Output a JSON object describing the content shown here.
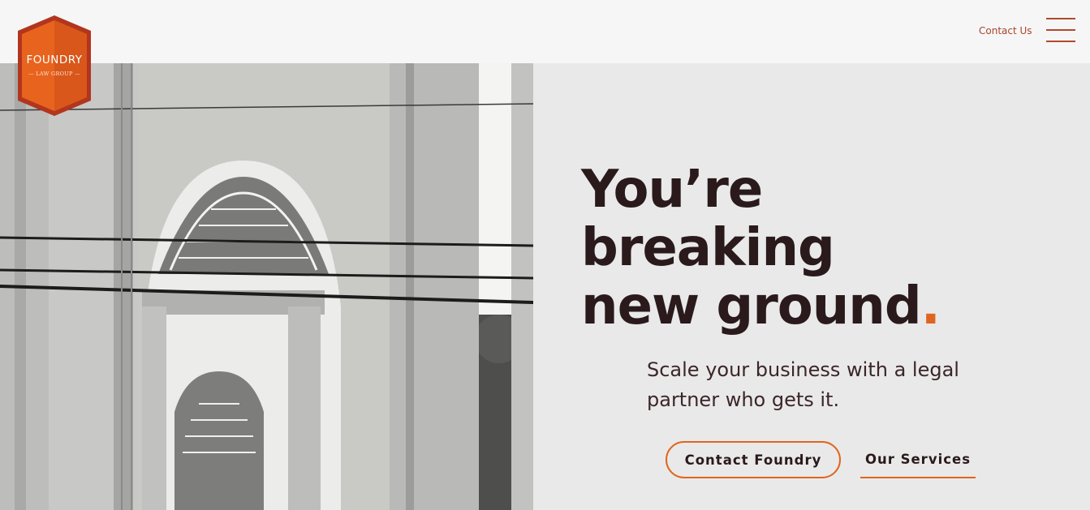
{
  "brand": {
    "logo_word": "FOUNDRY",
    "logo_sub": "— LAW GROUP —",
    "accent_color": "#e0651f",
    "logo_color": "#e8641e",
    "logo_border_color": "#b2351e"
  },
  "nav": {
    "contact_label": "Contact Us",
    "menu_icon": "hamburger-icon"
  },
  "hero": {
    "headline_line1": "You’re",
    "headline_line2": "breaking",
    "headline_line3": "new ground",
    "headline_dot": ".",
    "subhead": "Scale your business with a legal partner who gets it.",
    "primary_cta": "Contact Foundry",
    "secondary_cta": "Our Services"
  }
}
